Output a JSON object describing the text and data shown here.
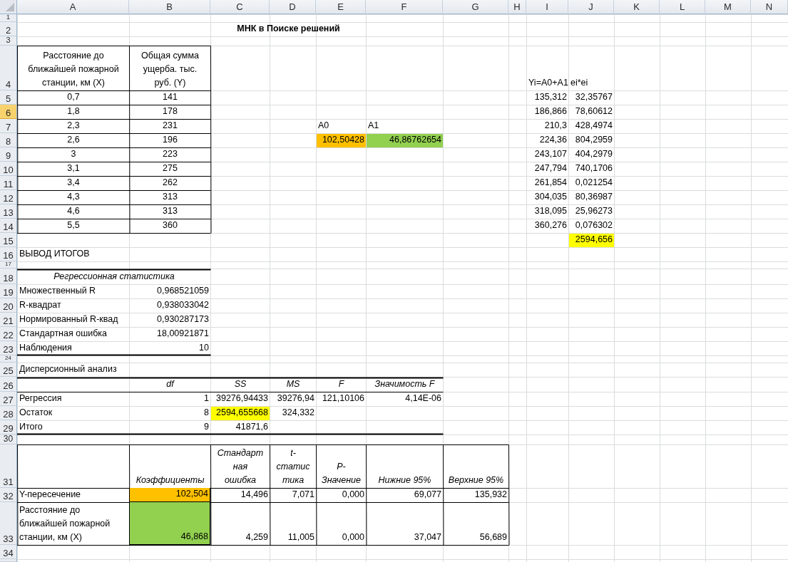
{
  "columns": [
    {
      "label": "A"
    },
    {
      "label": "B"
    },
    {
      "label": "C"
    },
    {
      "label": "D"
    },
    {
      "label": "E"
    },
    {
      "label": "F"
    },
    {
      "label": "G"
    },
    {
      "label": "H"
    },
    {
      "label": "I"
    },
    {
      "label": "J"
    },
    {
      "label": "K"
    },
    {
      "label": "L"
    },
    {
      "label": "M"
    },
    {
      "label": "N"
    }
  ],
  "rows": [
    {
      "label": "1",
      "selected": false
    },
    {
      "label": "2",
      "selected": false
    },
    {
      "label": "3",
      "selected": false
    },
    {
      "label": "4",
      "selected": false
    },
    {
      "label": "5",
      "selected": false
    },
    {
      "label": "6",
      "selected": true
    },
    {
      "label": "7",
      "selected": false
    },
    {
      "label": "8",
      "selected": false
    },
    {
      "label": "9",
      "selected": false
    },
    {
      "label": "10",
      "selected": false
    },
    {
      "label": "11",
      "selected": false
    },
    {
      "label": "12",
      "selected": false
    },
    {
      "label": "13",
      "selected": false
    },
    {
      "label": "14",
      "selected": false
    },
    {
      "label": "15",
      "selected": false
    },
    {
      "label": "16",
      "selected": false
    },
    {
      "label": "17",
      "selected": false
    },
    {
      "label": "18",
      "selected": false
    },
    {
      "label": "19",
      "selected": false
    },
    {
      "label": "20",
      "selected": false
    },
    {
      "label": "21",
      "selected": false
    },
    {
      "label": "22",
      "selected": false
    },
    {
      "label": "23",
      "selected": false
    },
    {
      "label": "24",
      "selected": false
    },
    {
      "label": "25",
      "selected": false
    },
    {
      "label": "26",
      "selected": false
    },
    {
      "label": "27",
      "selected": false
    },
    {
      "label": "28",
      "selected": false
    },
    {
      "label": "29",
      "selected": false
    },
    {
      "label": "30",
      "selected": false
    },
    {
      "label": "31",
      "selected": false
    },
    {
      "label": "32",
      "selected": false
    },
    {
      "label": "33",
      "selected": false
    },
    {
      "label": "34",
      "selected": false
    }
  ],
  "title": "МНК в Поиске решений",
  "input_table": {
    "headers": [
      "Расстояние до\nближайшей пожарной\nстанции, км (X)",
      "Общая сумма\nущерба. тыс.\nруб. (Y)"
    ],
    "rows": [
      [
        "0,7",
        "141"
      ],
      [
        "1,8",
        "178"
      ],
      [
        "2,3",
        "231"
      ],
      [
        "2,6",
        "196"
      ],
      [
        "3",
        "223"
      ],
      [
        "3,1",
        "275"
      ],
      [
        "3,4",
        "262"
      ],
      [
        "4,3",
        "313"
      ],
      [
        "4,6",
        "313"
      ],
      [
        "5,5",
        "360"
      ]
    ]
  },
  "parameters": {
    "labels": [
      "A0",
      "A1"
    ],
    "values": [
      {
        "text": "102,50428",
        "color": "#ffc000"
      },
      {
        "text": "46,86762654",
        "color": "#92d050"
      }
    ]
  },
  "fitted": {
    "headers": [
      "Yi=A0+A1",
      "ei*ei"
    ],
    "rows": [
      [
        "135,312",
        "32,35767"
      ],
      [
        "186,866",
        "78,60612"
      ],
      [
        "210,3",
        "428,4974"
      ],
      [
        "224,36",
        "804,2959"
      ],
      [
        "243,107",
        "404,2979"
      ],
      [
        "247,794",
        "740,1706"
      ],
      [
        "261,854",
        "0,021254"
      ],
      [
        "304,035",
        "80,36987"
      ],
      [
        "318,095",
        "25,96273"
      ],
      [
        "360,276",
        "0,076302"
      ]
    ],
    "total": {
      "text": "2594,656",
      "color": "#ffff00"
    }
  },
  "summary_title": "ВЫВОД ИТОГОВ",
  "regression_statistics": {
    "title": "Регрессионная статистика",
    "rows": [
      [
        "Множественный R",
        "0,968521059"
      ],
      [
        "R-квадрат",
        "0,938033042"
      ],
      [
        "Нормированный R-квад",
        "0,930287173"
      ],
      [
        "Стандартная ошибка",
        "18,00921871"
      ],
      [
        "Наблюдения",
        "10"
      ]
    ]
  },
  "anova": {
    "title": "Дисперсионный анализ",
    "headers": [
      "df",
      "SS",
      "MS",
      "F",
      "Значимость F"
    ],
    "rows": [
      {
        "label": "Регрессия",
        "values": [
          {
            "text": "1"
          },
          {
            "text": "39276,94433"
          },
          {
            "text": "39276,94"
          },
          {
            "text": "121,10106"
          },
          {
            "text": "4,14E-06"
          }
        ]
      },
      {
        "label": "Остаток",
        "values": [
          {
            "text": "8"
          },
          {
            "text": "2594,655668",
            "color": "#ffff00"
          },
          {
            "text": "324,332"
          }
        ]
      },
      {
        "label": "Итого",
        "values": [
          {
            "text": "9"
          },
          {
            "text": "41871,6"
          }
        ]
      }
    ]
  },
  "coefficients": {
    "headers": [
      "Коэффициенты",
      "Стандарт\nная\nошибка",
      "t-\nстатис\nтика",
      "P-\nЗначение",
      "Нижние 95%",
      "Верхние 95%"
    ],
    "rows": [
      {
        "label": "Y-пересечение",
        "values": [
          {
            "text": "102,504",
            "color": "#ffc000"
          },
          {
            "text": "14,496"
          },
          {
            "text": "7,071"
          },
          {
            "text": "0,000"
          },
          {
            "text": "69,077"
          },
          {
            "text": "135,932"
          }
        ]
      },
      {
        "label": "Расстояние до\nближайшей пожарной\nстанции, км (X)",
        "values": [
          {
            "text": "46,868",
            "color": "#92d050"
          },
          {
            "text": "4,259"
          },
          {
            "text": "11,005"
          },
          {
            "text": "0,000"
          },
          {
            "text": "37,047"
          },
          {
            "text": "56,689"
          }
        ]
      }
    ]
  }
}
